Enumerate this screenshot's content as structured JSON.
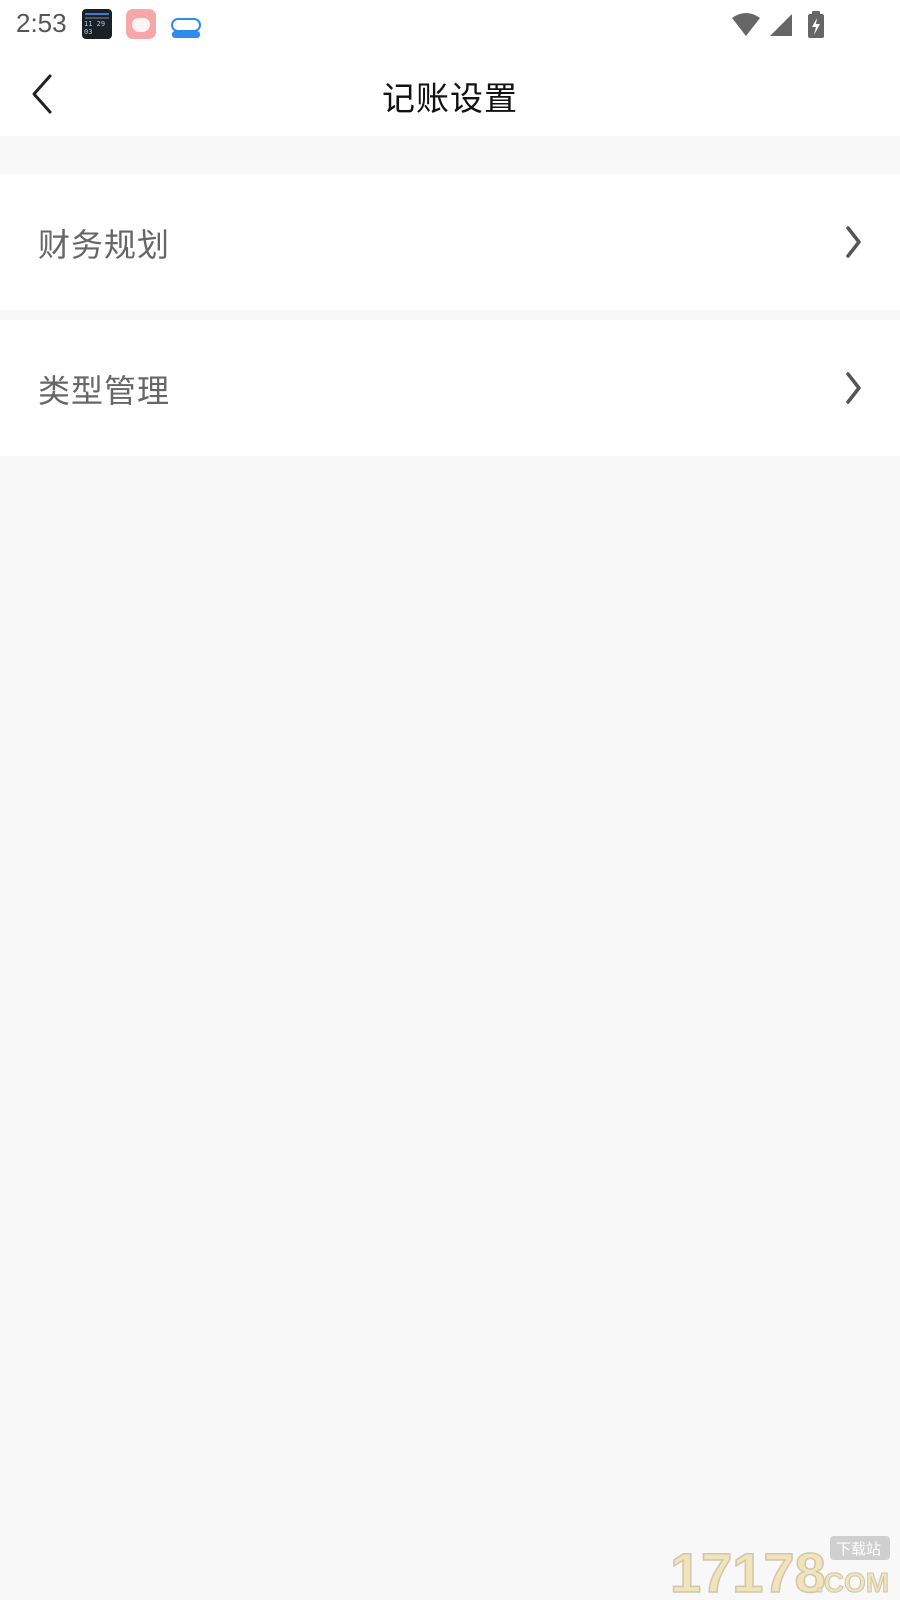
{
  "status_bar": {
    "time": "2:53",
    "notifications": [
      "clock-app-icon",
      "rice-app-icon",
      "cloud-app-icon"
    ],
    "clock_digits": "11 29 03",
    "indicators": [
      "wifi-icon",
      "cellular-signal-icon",
      "battery-charging-icon"
    ]
  },
  "header": {
    "title": "记账设置",
    "back_icon": "chevron-left-icon"
  },
  "settings": {
    "items": [
      {
        "label": "财务规划",
        "icon": "chevron-right-icon"
      },
      {
        "label": "类型管理",
        "icon": "chevron-right-icon"
      }
    ]
  },
  "watermark": {
    "number": "17178",
    "suffix": ".COM",
    "tag": "下载站"
  },
  "colors": {
    "page_background": "#f8f8f8",
    "surface": "#ffffff",
    "title_text": "#111111",
    "item_text": "#666666",
    "watermark_fill": "#f3e3b8"
  }
}
